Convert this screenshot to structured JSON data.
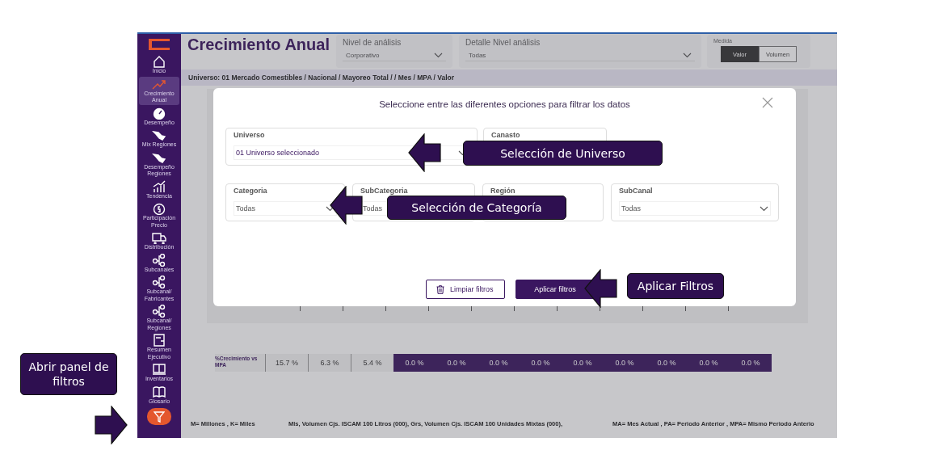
{
  "sidebar": {
    "items": [
      {
        "label": "Inicio",
        "selected": false
      },
      {
        "label": "Crecimiento Anual",
        "selected": true
      },
      {
        "label": "Desempeño",
        "selected": false
      },
      {
        "label": "Mix Regiones",
        "selected": false
      },
      {
        "label": "Desempeño Regiones",
        "selected": false
      },
      {
        "label": "Tendencia",
        "selected": false
      },
      {
        "label": "Participación Precio",
        "selected": false
      },
      {
        "label": "Distribución",
        "selected": false
      },
      {
        "label": "Subcanales",
        "selected": false
      },
      {
        "label": "Subcanal/ Fabricantes",
        "selected": false
      },
      {
        "label": "Subcanal/ Regiones",
        "selected": false
      },
      {
        "label": "Resumen Ejecutivo",
        "selected": false
      },
      {
        "label": "Inventarios",
        "selected": false
      },
      {
        "label": "Glosario",
        "selected": false
      }
    ]
  },
  "header": {
    "title": "Crecimiento Anual",
    "filters": [
      {
        "label": "Nivel de análisis",
        "value": "Corporativo"
      },
      {
        "label": "Detalle Nivel análisis",
        "value": "Todas"
      }
    ],
    "medida": {
      "label": "Medida",
      "options": [
        {
          "label": "Valor",
          "selected": true
        },
        {
          "label": "Volumen",
          "selected": false
        }
      ]
    }
  },
  "breadcrumb": "Universo: 01 Mercado Comestibles / Nacional / Mayoreo Total / / Mes / MPA / Valor",
  "growth_row": {
    "label": "%Crecimiento vs MPA",
    "values": [
      {
        "text": "15.7 %",
        "highlighted": false
      },
      {
        "text": "6.3 %",
        "highlighted": false
      },
      {
        "text": "5.4 %",
        "highlighted": false
      },
      {
        "text": "0.0 %",
        "highlighted": true
      },
      {
        "text": "0.0 %",
        "highlighted": true
      },
      {
        "text": "0.0 %",
        "highlighted": true
      },
      {
        "text": "0.0 %",
        "highlighted": true
      },
      {
        "text": "0.0 %",
        "highlighted": true
      },
      {
        "text": "0.0 %",
        "highlighted": true
      },
      {
        "text": "0.0 %",
        "highlighted": true
      },
      {
        "text": "0.0 %",
        "highlighted": true
      },
      {
        "text": "0.0 %",
        "highlighted": true
      }
    ]
  },
  "footer": [
    "M= Millones , K= Miles",
    "Mls, Volumen Cjs. ISCAM 100 Litros (000), Grs, Volumen Cjs. ISCAM 100 Unidades Mixtas (000),",
    "MA= Mes Actual , PA= Periodo Anterior , MPA= Mismo Periodo Anterio"
  ],
  "modal": {
    "title": "Seleccione entre las diferentes opciones para filtrar los datos",
    "top_fields": [
      {
        "label": "Universo",
        "value": "01 Universo seleccionado"
      },
      {
        "label": "Canasto"
      }
    ],
    "bottom_fields": [
      {
        "label": "Categoria",
        "value": "Todas"
      },
      {
        "label": "SubCategoria",
        "value": "Todas"
      },
      {
        "label": "Región"
      },
      {
        "label": "SubCanal",
        "value": "Todas"
      }
    ],
    "buttons": [
      {
        "label": "Limpiar filtros",
        "kind": "secondary"
      },
      {
        "label": "Aplicar filtros",
        "kind": "primary"
      }
    ]
  },
  "annotations": [
    {
      "text": "Selección de Universo"
    },
    {
      "text": "Selección de Categoría"
    },
    {
      "text": "Aplicar Filtros"
    },
    {
      "text": "Abrir panel de filtros"
    }
  ]
}
